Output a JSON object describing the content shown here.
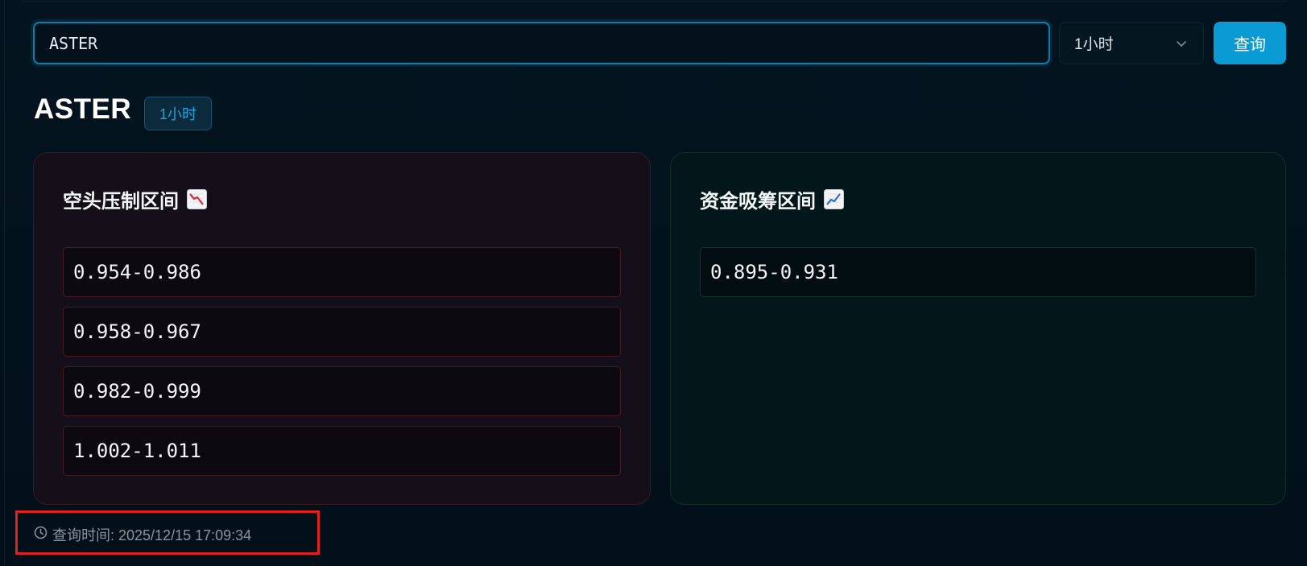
{
  "search": {
    "value": "ASTER"
  },
  "interval_select": {
    "selected": "1小时",
    "chevron_icon": "chevron-down-icon"
  },
  "query_button": {
    "label": "查询"
  },
  "heading": {
    "symbol": "ASTER",
    "interval_badge": "1小时"
  },
  "bear_panel": {
    "title": "空头压制区间",
    "icon": "chart-decreasing-icon",
    "ranges": [
      "0.954-0.986",
      "0.958-0.967",
      "0.982-0.999",
      "1.002-1.011"
    ]
  },
  "bull_panel": {
    "title": "资金吸筹区间",
    "icon": "chart-increasing-icon",
    "ranges": [
      "0.895-0.931"
    ]
  },
  "footer": {
    "query_time": "查询时间: 2025/12/15 17:09:34",
    "clock_icon": "clock-icon"
  },
  "colors": {
    "accent": "#0a9bd5",
    "bear_border": "#4a1a22",
    "bull_border": "#12342d",
    "highlight": "#e3211c"
  }
}
